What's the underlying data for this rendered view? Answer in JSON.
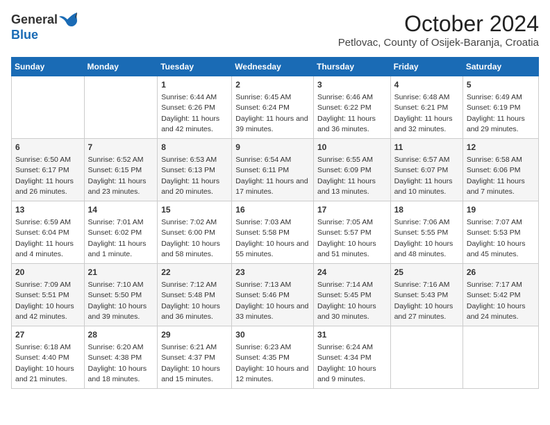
{
  "header": {
    "logo_general": "General",
    "logo_blue": "Blue",
    "month": "October 2024",
    "location": "Petlovac, County of Osijek-Baranja, Croatia"
  },
  "weekdays": [
    "Sunday",
    "Monday",
    "Tuesday",
    "Wednesday",
    "Thursday",
    "Friday",
    "Saturday"
  ],
  "weeks": [
    [
      {
        "day": "",
        "info": ""
      },
      {
        "day": "",
        "info": ""
      },
      {
        "day": "1",
        "info": "Sunrise: 6:44 AM\nSunset: 6:26 PM\nDaylight: 11 hours and 42 minutes."
      },
      {
        "day": "2",
        "info": "Sunrise: 6:45 AM\nSunset: 6:24 PM\nDaylight: 11 hours and 39 minutes."
      },
      {
        "day": "3",
        "info": "Sunrise: 6:46 AM\nSunset: 6:22 PM\nDaylight: 11 hours and 36 minutes."
      },
      {
        "day": "4",
        "info": "Sunrise: 6:48 AM\nSunset: 6:21 PM\nDaylight: 11 hours and 32 minutes."
      },
      {
        "day": "5",
        "info": "Sunrise: 6:49 AM\nSunset: 6:19 PM\nDaylight: 11 hours and 29 minutes."
      }
    ],
    [
      {
        "day": "6",
        "info": "Sunrise: 6:50 AM\nSunset: 6:17 PM\nDaylight: 11 hours and 26 minutes."
      },
      {
        "day": "7",
        "info": "Sunrise: 6:52 AM\nSunset: 6:15 PM\nDaylight: 11 hours and 23 minutes."
      },
      {
        "day": "8",
        "info": "Sunrise: 6:53 AM\nSunset: 6:13 PM\nDaylight: 11 hours and 20 minutes."
      },
      {
        "day": "9",
        "info": "Sunrise: 6:54 AM\nSunset: 6:11 PM\nDaylight: 11 hours and 17 minutes."
      },
      {
        "day": "10",
        "info": "Sunrise: 6:55 AM\nSunset: 6:09 PM\nDaylight: 11 hours and 13 minutes."
      },
      {
        "day": "11",
        "info": "Sunrise: 6:57 AM\nSunset: 6:07 PM\nDaylight: 11 hours and 10 minutes."
      },
      {
        "day": "12",
        "info": "Sunrise: 6:58 AM\nSunset: 6:06 PM\nDaylight: 11 hours and 7 minutes."
      }
    ],
    [
      {
        "day": "13",
        "info": "Sunrise: 6:59 AM\nSunset: 6:04 PM\nDaylight: 11 hours and 4 minutes."
      },
      {
        "day": "14",
        "info": "Sunrise: 7:01 AM\nSunset: 6:02 PM\nDaylight: 11 hours and 1 minute."
      },
      {
        "day": "15",
        "info": "Sunrise: 7:02 AM\nSunset: 6:00 PM\nDaylight: 10 hours and 58 minutes."
      },
      {
        "day": "16",
        "info": "Sunrise: 7:03 AM\nSunset: 5:58 PM\nDaylight: 10 hours and 55 minutes."
      },
      {
        "day": "17",
        "info": "Sunrise: 7:05 AM\nSunset: 5:57 PM\nDaylight: 10 hours and 51 minutes."
      },
      {
        "day": "18",
        "info": "Sunrise: 7:06 AM\nSunset: 5:55 PM\nDaylight: 10 hours and 48 minutes."
      },
      {
        "day": "19",
        "info": "Sunrise: 7:07 AM\nSunset: 5:53 PM\nDaylight: 10 hours and 45 minutes."
      }
    ],
    [
      {
        "day": "20",
        "info": "Sunrise: 7:09 AM\nSunset: 5:51 PM\nDaylight: 10 hours and 42 minutes."
      },
      {
        "day": "21",
        "info": "Sunrise: 7:10 AM\nSunset: 5:50 PM\nDaylight: 10 hours and 39 minutes."
      },
      {
        "day": "22",
        "info": "Sunrise: 7:12 AM\nSunset: 5:48 PM\nDaylight: 10 hours and 36 minutes."
      },
      {
        "day": "23",
        "info": "Sunrise: 7:13 AM\nSunset: 5:46 PM\nDaylight: 10 hours and 33 minutes."
      },
      {
        "day": "24",
        "info": "Sunrise: 7:14 AM\nSunset: 5:45 PM\nDaylight: 10 hours and 30 minutes."
      },
      {
        "day": "25",
        "info": "Sunrise: 7:16 AM\nSunset: 5:43 PM\nDaylight: 10 hours and 27 minutes."
      },
      {
        "day": "26",
        "info": "Sunrise: 7:17 AM\nSunset: 5:42 PM\nDaylight: 10 hours and 24 minutes."
      }
    ],
    [
      {
        "day": "27",
        "info": "Sunrise: 6:18 AM\nSunset: 4:40 PM\nDaylight: 10 hours and 21 minutes."
      },
      {
        "day": "28",
        "info": "Sunrise: 6:20 AM\nSunset: 4:38 PM\nDaylight: 10 hours and 18 minutes."
      },
      {
        "day": "29",
        "info": "Sunrise: 6:21 AM\nSunset: 4:37 PM\nDaylight: 10 hours and 15 minutes."
      },
      {
        "day": "30",
        "info": "Sunrise: 6:23 AM\nSunset: 4:35 PM\nDaylight: 10 hours and 12 minutes."
      },
      {
        "day": "31",
        "info": "Sunrise: 6:24 AM\nSunset: 4:34 PM\nDaylight: 10 hours and 9 minutes."
      },
      {
        "day": "",
        "info": ""
      },
      {
        "day": "",
        "info": ""
      }
    ]
  ]
}
